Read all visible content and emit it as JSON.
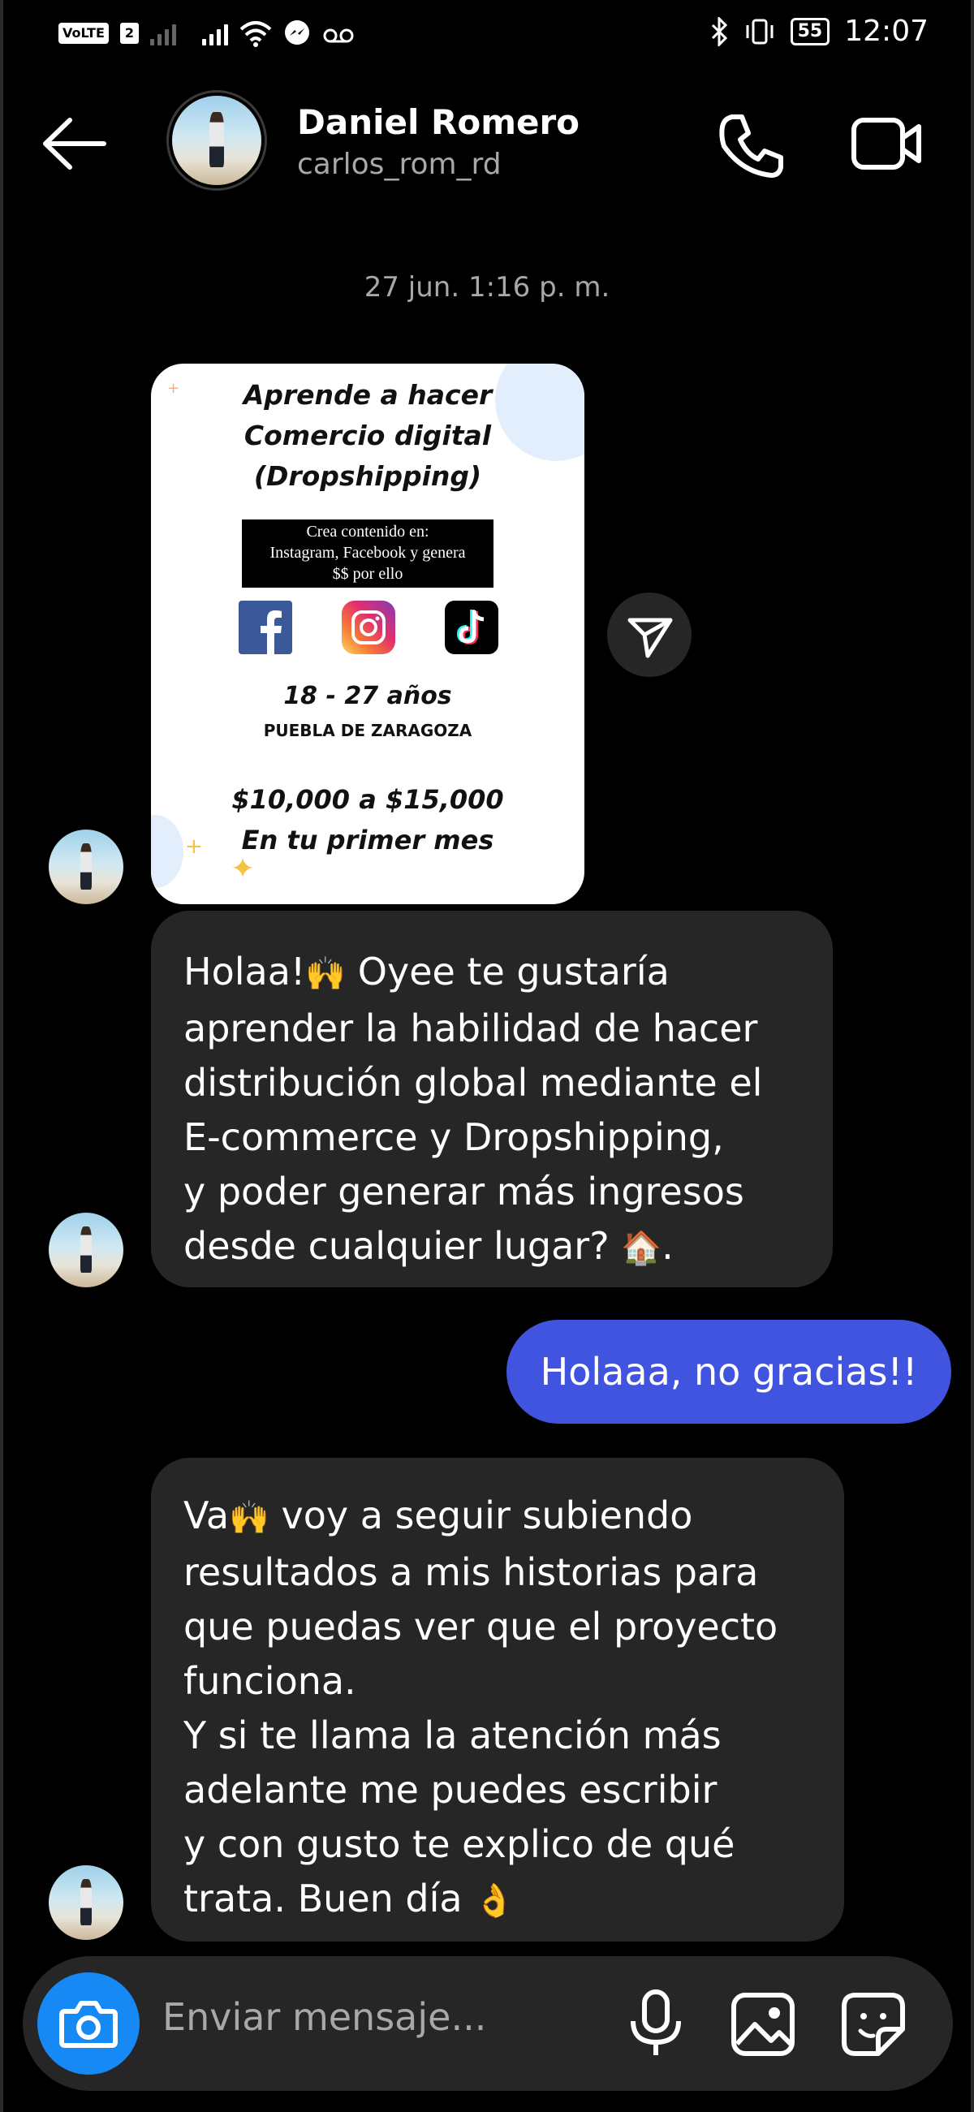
{
  "status_bar": {
    "volte": "VoLTE",
    "sim": "2",
    "messenger_icon": "messenger-icon",
    "voicemail_icon": "voicemail-icon",
    "battery": "55",
    "time": "12:07"
  },
  "header": {
    "name": "Daniel Romero",
    "username": "carlos_rom_rd"
  },
  "timestamp": "27 jun. 1:16 p. m.",
  "poster": {
    "title_line1": "Aprende a hacer",
    "title_line2": "Comercio digital",
    "title_line3": "(Dropshipping)",
    "box_line1": "Crea contenido en:",
    "box_line2": "Instagram, Facebook y genera",
    "box_line3": "$$ por ello",
    "age": "18 - 27 años",
    "city": "PUEBLA DE ZARAGOZA",
    "money_line1": "$10,000 a $15,000",
    "money_line2": "En tu primer mes"
  },
  "messages": {
    "first": {
      "line1": "Holaa!",
      "emoji1": "🙌",
      "line1b": "  Oyee te gustaría",
      "line2": "aprender la habilidad de hacer",
      "line3": "distribución global mediante el",
      "line4": "E-commerce y Dropshipping,",
      "line5": "y poder generar más ingresos",
      "line6": "desde cualquier lugar? ",
      "emoji2": "🏠",
      "line6b": "."
    },
    "mine": "Holaaa, no gracias!!",
    "second": {
      "line1a": "Va",
      "emoji1": "🙌",
      "line1b": " voy a seguir subiendo",
      "line2": "resultados a mis historias para",
      "line3": "que puedas ver que el proyecto",
      "line4": "funciona.",
      "line5": "Y si te llama la atención más",
      "line6": "adelante me puedes escribir",
      "line7": "y con gusto te explico de qué",
      "line8": "trata.  Buen día ",
      "emoji2": "👌"
    }
  },
  "composer": {
    "placeholder": "Enviar mensaje..."
  },
  "colors": {
    "background": "#000000",
    "bubble_received": "#262626",
    "bubble_sent": "#4154e0",
    "camera_button": "#1689f5",
    "secondary_text": "#a8a8a8"
  }
}
